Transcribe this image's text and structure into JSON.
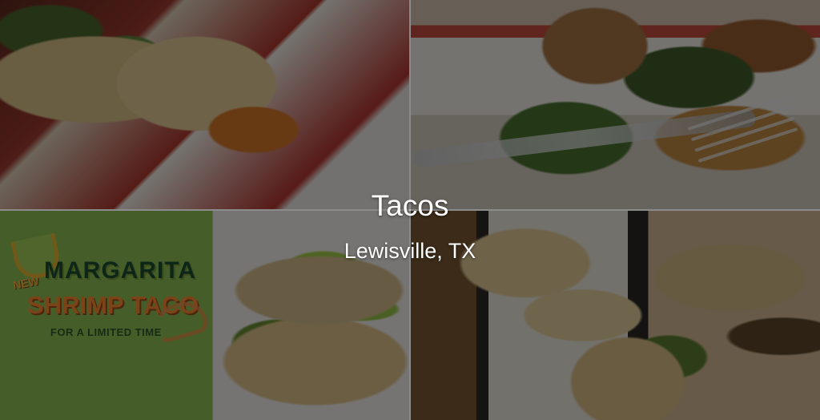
{
  "overlay": {
    "title": "Tacos",
    "location": "Lewisville, TX"
  },
  "promo": {
    "new": "NEW",
    "line1": "MARGARITA",
    "line2": "SHRIMP TACO",
    "line3": "FOR A LIMITED TIME"
  },
  "icons": {
    "lime": "lime-icon",
    "shrimp": "shrimp-icon",
    "fork": "fork-icon"
  },
  "colors": {
    "overlay_text": "#ffffff",
    "promo_green": "#1f5134",
    "promo_orange": "#ff8c32",
    "promo_background": "#91c456"
  }
}
